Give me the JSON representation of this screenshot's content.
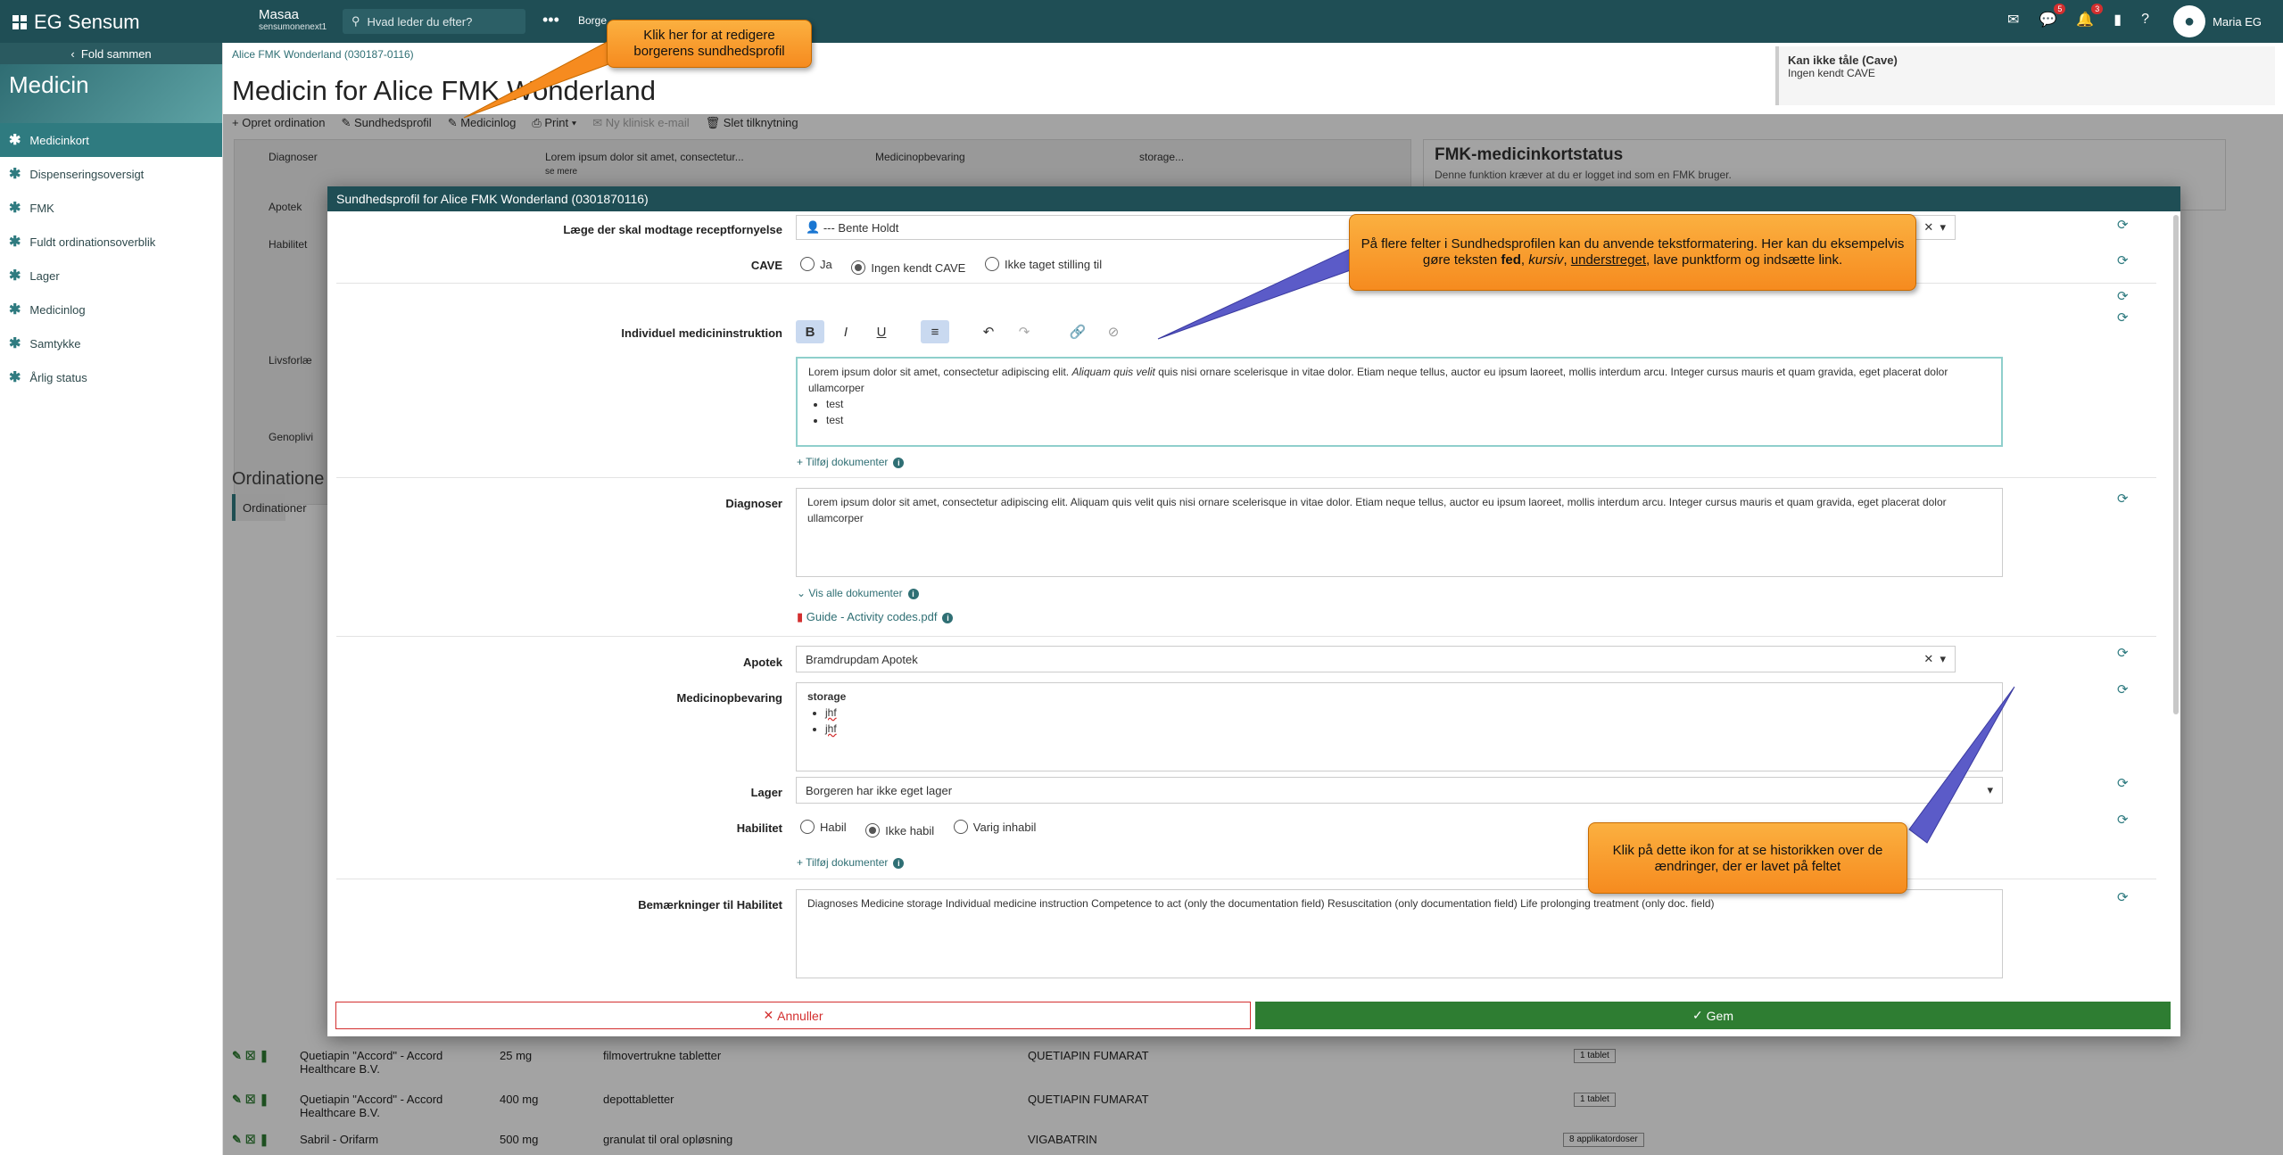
{
  "topbar": {
    "brand": "EG Sensum",
    "context_name": "Masaa",
    "context_sub": "sensumonenext1",
    "search_placeholder": "Hvad leder du efter?",
    "crumb": "Borge",
    "notif_badge_1": "5",
    "notif_badge_2": "3",
    "user_name": "Maria EG"
  },
  "sidebar": {
    "fold_label": "Fold sammen",
    "hero_title": "Medicin",
    "items": [
      {
        "label": "Medicinkort"
      },
      {
        "label": "Dispenseringsoversigt"
      },
      {
        "label": "FMK"
      },
      {
        "label": "Fuldt ordinationsoverblik"
      },
      {
        "label": "Lager"
      },
      {
        "label": "Medicinlog"
      },
      {
        "label": "Samtykke"
      },
      {
        "label": "Årlig status"
      }
    ]
  },
  "main": {
    "breadcrumb": "Alice FMK Wonderland (030187-0116)",
    "page_title": "Medicin for Alice FMK Wonderland",
    "cave_title": "Kan ikke tåle (Cave)",
    "cave_value": "Ingen kendt CAVE",
    "toolbar": [
      "Opret ordination",
      "Sundhedsprofil",
      "Medicinlog",
      "Print",
      "Ny klinisk e-mail",
      "Slet tilknytning"
    ],
    "bg_rows": {
      "diagnoser": "Diagnoser",
      "diagnoser_text": "Lorem ipsum dolor sit amet, consectetur...",
      "se_mere": "se mere",
      "medicinopbevaring": "Medicinopbevaring",
      "storage": "storage...",
      "apotek": "Apotek",
      "habilitet": "Habilitet",
      "livsforl": "Livsforlæ",
      "genopliv": "Genoplivi"
    },
    "fmk_title": "FMK-medicinkortstatus",
    "fmk_text": "Denne funktion kræver at du er logget ind som en FMK bruger.",
    "ord_title": "Ordinatione",
    "ord_tab": "Ordinationer",
    "med_rows": [
      {
        "name": "Quetiapin \"Accord\" - Accord Healthcare B.V.",
        "dose": "25 mg",
        "form": "filmovertrukne tabletter",
        "substance": "QUETIAPIN FUMARAT",
        "unit": "1 tablet"
      },
      {
        "name": "Quetiapin \"Accord\" - Accord Healthcare B.V.",
        "dose": "400 mg",
        "form": "depottabletter",
        "substance": "QUETIAPIN FUMARAT",
        "unit": "1 tablet"
      },
      {
        "name": "Sabril - Orifarm",
        "dose": "500 mg",
        "form": "granulat til oral opløsning",
        "substance": "VIGABATRIN",
        "unit": "8 applikatordoser"
      }
    ]
  },
  "modal": {
    "title": "Sundhedsprofil for Alice FMK Wonderland (0301870116)",
    "fields": {
      "laege_label": "Læge der skal modtage receptfornyelse",
      "laege_value": "--- Bente Holdt",
      "cave_label": "CAVE",
      "cave_opts": [
        "Ja",
        "Ingen kendt CAVE",
        "Ikke taget stilling til"
      ],
      "instr_label": "Individuel medicininstruktion",
      "instr_text_1": "Lorem ipsum dolor sit amet, consectetur adipiscing elit.",
      "instr_text_2": "Aliquam quis velit",
      "instr_text_3": "quis nisi ornare scelerisque in vitae dolor. Etiam neque tellus, auctor eu ipsum laoreet, mollis interdum arcu. Integer cursus mauris et quam gravida, eget placerat dolor ullamcorper",
      "instr_list": [
        "test",
        "test"
      ],
      "add_doc": "Tilføj dokumenter",
      "diag_label": "Diagnoser",
      "diag_text": "Lorem ipsum dolor sit amet, consectetur adipiscing elit. Aliquam quis velit quis nisi ornare scelerisque in vitae dolor. Etiam neque tellus, auctor eu ipsum laoreet, mollis interdum arcu. Integer cursus mauris et quam gravida, eget placerat dolor ullamcorper",
      "show_all_docs": "Vis alle dokumenter",
      "doc_file": "Guide - Activity codes.pdf",
      "apotek_label": "Apotek",
      "apotek_value": "Bramdrupdam Apotek",
      "opbev_label": "Medicinopbevaring",
      "opbev_title": "storage",
      "opbev_list": [
        "jhf",
        "jhf"
      ],
      "lager_label": "Lager",
      "lager_value": "Borgeren har ikke eget lager",
      "habil_label": "Habilitet",
      "habil_opts": [
        "Habil",
        "Ikke habil",
        "Varig inhabil"
      ],
      "add_doc_2": "Tilføj dokumenter",
      "bem_label": "Bemærkninger til Habilitet",
      "bem_text": "Diagnoses Medicine storage Individual medicine instruction Competence to act (only the documentation field) Resuscitation (only documentation field) Life prolonging treatment (only doc. field)"
    },
    "cancel_label": "Annuller",
    "save_label": "Gem"
  },
  "callouts": {
    "c1": "Klik her for at redigere borgerens sundhedsprofil",
    "c2_a": "På flere felter i Sundhedsprofilen kan du anvende tekstformatering. Her kan du eksempelvis gøre teksten",
    "c2_bold": "fed",
    "c2_italic": "kursiv",
    "c2_underline": "understreget",
    "c2_b": ", lave punktform og indsætte link.",
    "c3": "Klik på dette ikon for at se historikken over de ændringer, der er lavet på feltet"
  },
  "colors": {
    "brand": "#1f4e55",
    "accent": "#2f7b80",
    "save": "#2e7d32",
    "cancel": "#d32f2f",
    "callout": "#f68b1f"
  }
}
